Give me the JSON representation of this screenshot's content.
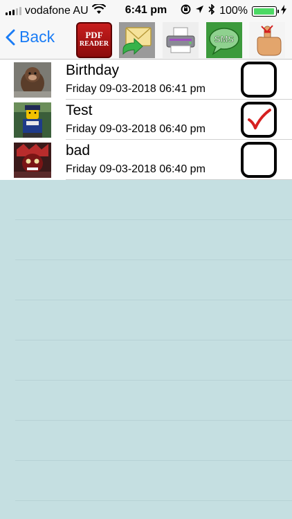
{
  "status": {
    "carrier": "vodafone AU",
    "time": "6:41 pm",
    "battery": "100%",
    "battery_level": 1.0
  },
  "nav": {
    "back_label": "Back",
    "pdf_line1": "PDF",
    "pdf_line2": "READER",
    "sms_label": "SMS"
  },
  "items": [
    {
      "title": "Birthday",
      "date": "Friday 09-03-2018 06:41 pm",
      "checked": false
    },
    {
      "title": "Test",
      "date": "Friday 09-03-2018 06:40 pm",
      "checked": true
    },
    {
      "title": "bad",
      "date": "Friday 09-03-2018 06:40 pm",
      "checked": false
    }
  ],
  "colors": {
    "accent": "#1a7cf5",
    "check_mark": "#d62020",
    "background": "#c5dfe1"
  }
}
